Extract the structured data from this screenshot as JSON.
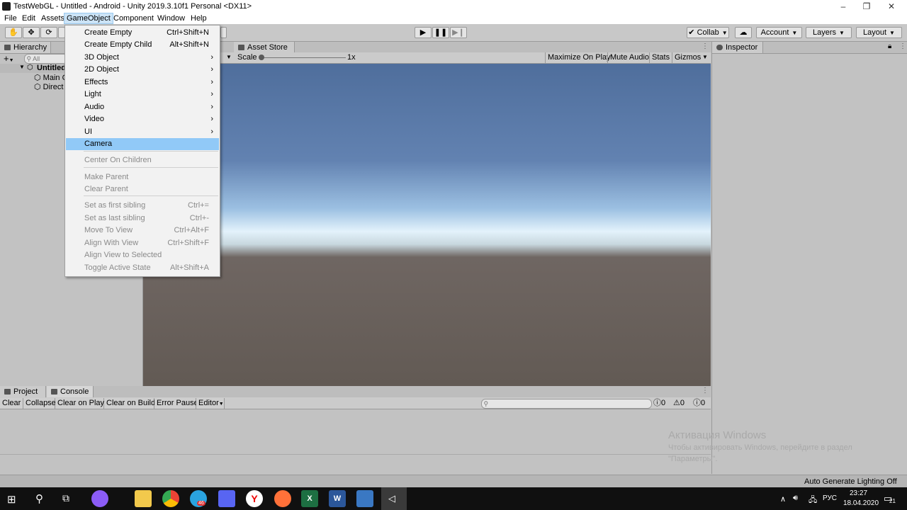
{
  "window": {
    "title": "TestWebGL - Untitled - Android - Unity 2019.3.10f1 Personal <DX11>",
    "minimize": "–",
    "restore": "❐",
    "close": "✕"
  },
  "menubar": [
    "File",
    "Edit",
    "Assets",
    "GameObject",
    "Component",
    "Window",
    "Help"
  ],
  "toolbar": {
    "collab": "Collab",
    "account": "Account",
    "layers": "Layers",
    "layout": "Layout"
  },
  "hierarchy": {
    "tab": "Hierarchy",
    "add": "+",
    "search_placeholder": "All",
    "scene": "Untitled",
    "items": [
      "Main C",
      "Direct"
    ]
  },
  "game": {
    "tab": "Asset Store",
    "scale_label": "Scale",
    "scale_value": "1x",
    "buttons": [
      "Maximize On Play",
      "Mute Audio",
      "Stats",
      "Gizmos"
    ]
  },
  "inspector": {
    "tab": "Inspector"
  },
  "gameobject_menu": {
    "items": [
      {
        "label": "Create Empty",
        "shortcut": "Ctrl+Shift+N",
        "enabled": true
      },
      {
        "label": "Create Empty Child",
        "shortcut": "Alt+Shift+N",
        "enabled": true
      },
      {
        "label": "3D Object",
        "submenu": true,
        "enabled": true
      },
      {
        "label": "2D Object",
        "submenu": true,
        "enabled": true
      },
      {
        "label": "Effects",
        "submenu": true,
        "enabled": true
      },
      {
        "label": "Light",
        "submenu": true,
        "enabled": true
      },
      {
        "label": "Audio",
        "submenu": true,
        "enabled": true
      },
      {
        "label": "Video",
        "submenu": true,
        "enabled": true
      },
      {
        "label": "UI",
        "submenu": true,
        "enabled": true
      },
      {
        "label": "Camera",
        "highlighted": true,
        "enabled": true
      },
      {
        "label": "Center On Children",
        "enabled": false
      },
      {
        "label": "Make Parent",
        "enabled": false
      },
      {
        "label": "Clear Parent",
        "enabled": false
      },
      {
        "label": "Set as first sibling",
        "shortcut": "Ctrl+=",
        "enabled": false
      },
      {
        "label": "Set as last sibling",
        "shortcut": "Ctrl+-",
        "enabled": false
      },
      {
        "label": "Move To View",
        "shortcut": "Ctrl+Alt+F",
        "enabled": false
      },
      {
        "label": "Align With View",
        "shortcut": "Ctrl+Shift+F",
        "enabled": false
      },
      {
        "label": "Align View to Selected",
        "enabled": false
      },
      {
        "label": "Toggle Active State",
        "shortcut": "Alt+Shift+A",
        "enabled": false
      }
    ]
  },
  "bottom": {
    "tabs": [
      "Project",
      "Console"
    ],
    "console_buttons": [
      "Clear",
      "Collapse",
      "Clear on Play",
      "Clear on Build",
      "Error Pause",
      "Editor"
    ],
    "counts": [
      "0",
      "0",
      "0"
    ]
  },
  "watermark": {
    "line1": "Активация Windows",
    "line2": "Чтобы активировать Windows, перейдите в раздел",
    "line3": "\"Параметры\"."
  },
  "status": "Auto Generate Lighting Off",
  "taskbar": {
    "badge": "46",
    "tray_lang": "РУС",
    "time": "23:27",
    "date": "18.04.2020",
    "notif": "21"
  },
  "colors": {
    "menu_highlight": "#91c9f7",
    "taskbar": "#101010",
    "editor_bg": "#c2c2c2"
  }
}
